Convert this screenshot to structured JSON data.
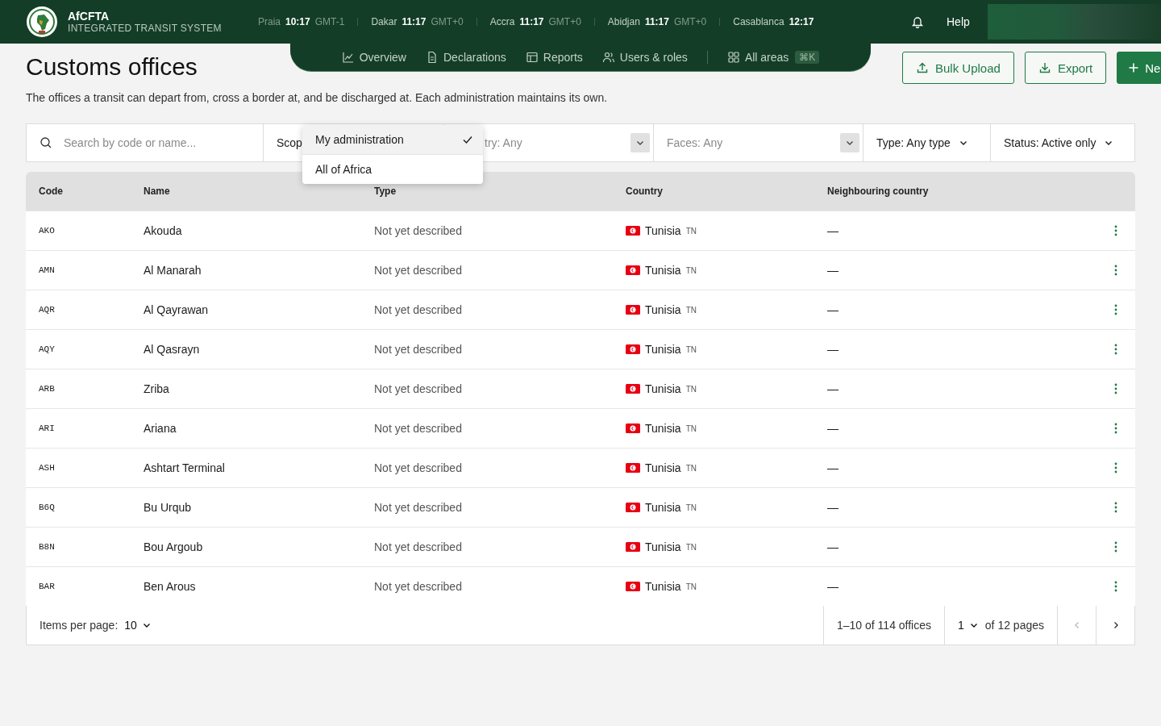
{
  "header": {
    "brand": "AfCFTA",
    "subtitle": "INTEGRATED TRANSIT SYSTEM",
    "clocks": [
      {
        "city": "Praia",
        "time": "10:17",
        "zone": "GMT-1"
      },
      {
        "city": "Dakar",
        "time": "11:17",
        "zone": "GMT+0"
      },
      {
        "city": "Accra",
        "time": "11:17",
        "zone": "GMT+0"
      },
      {
        "city": "Abidjan",
        "time": "11:17",
        "zone": "GMT+0"
      },
      {
        "city": "Casablanca",
        "time": "12:17"
      }
    ],
    "help": "Help"
  },
  "nav": [
    {
      "label": "Overview"
    },
    {
      "label": "Declarations"
    },
    {
      "label": "Reports"
    },
    {
      "label": "Users & roles"
    },
    {
      "label": "All areas",
      "shortcut": "⌘K"
    }
  ],
  "page": {
    "title": "Customs offices",
    "description": "The offices a transit can depart from, cross a border at, and be discharged at. Each administration maintains its own.",
    "actions": [
      {
        "label": "Bulk Upload",
        "kind": "upload"
      },
      {
        "label": "Export",
        "kind": "export"
      },
      {
        "label": "Ne",
        "kind": "new"
      }
    ]
  },
  "filters": {
    "search_placeholder": "Search by code or name...",
    "scope": "Scop",
    "country": "try: Any",
    "faces": "Faces: Any",
    "type": "Type: Any type",
    "status": "Status: Active only"
  },
  "scope_menu": [
    {
      "label": "My administration",
      "selected": true
    },
    {
      "label": "All of Africa",
      "selected": false
    }
  ],
  "table": {
    "columns": [
      "Code",
      "Name",
      "Type",
      "Country",
      "Neighbouring country"
    ],
    "rows": [
      {
        "code": "AKO",
        "name": "Akouda",
        "type": "Not yet described",
        "country": "Tunisia",
        "country_code": "TN",
        "neighbour": "—"
      },
      {
        "code": "AMN",
        "name": "Al Manarah",
        "type": "Not yet described",
        "country": "Tunisia",
        "country_code": "TN",
        "neighbour": "—"
      },
      {
        "code": "AQR",
        "name": "Al Qayrawan",
        "type": "Not yet described",
        "country": "Tunisia",
        "country_code": "TN",
        "neighbour": "—"
      },
      {
        "code": "AQY",
        "name": "Al Qasrayn",
        "type": "Not yet described",
        "country": "Tunisia",
        "country_code": "TN",
        "neighbour": "—"
      },
      {
        "code": "ARB",
        "name": "Zriba",
        "type": "Not yet described",
        "country": "Tunisia",
        "country_code": "TN",
        "neighbour": "—"
      },
      {
        "code": "ARI",
        "name": "Ariana",
        "type": "Not yet described",
        "country": "Tunisia",
        "country_code": "TN",
        "neighbour": "—"
      },
      {
        "code": "ASH",
        "name": "Ashtart Terminal",
        "type": "Not yet described",
        "country": "Tunisia",
        "country_code": "TN",
        "neighbour": "—"
      },
      {
        "code": "B6Q",
        "name": "Bu Urqub",
        "type": "Not yet described",
        "country": "Tunisia",
        "country_code": "TN",
        "neighbour": "—"
      },
      {
        "code": "B8N",
        "name": "Bou Argoub",
        "type": "Not yet described",
        "country": "Tunisia",
        "country_code": "TN",
        "neighbour": "—"
      },
      {
        "code": "BAR",
        "name": "Ben Arous",
        "type": "Not yet described",
        "country": "Tunisia",
        "country_code": "TN",
        "neighbour": "—"
      }
    ]
  },
  "pagination": {
    "per_page_label": "Items per page:",
    "per_page": "10",
    "range": "1–10 of 114 offices",
    "page": "1",
    "pages": "of 12 pages"
  }
}
